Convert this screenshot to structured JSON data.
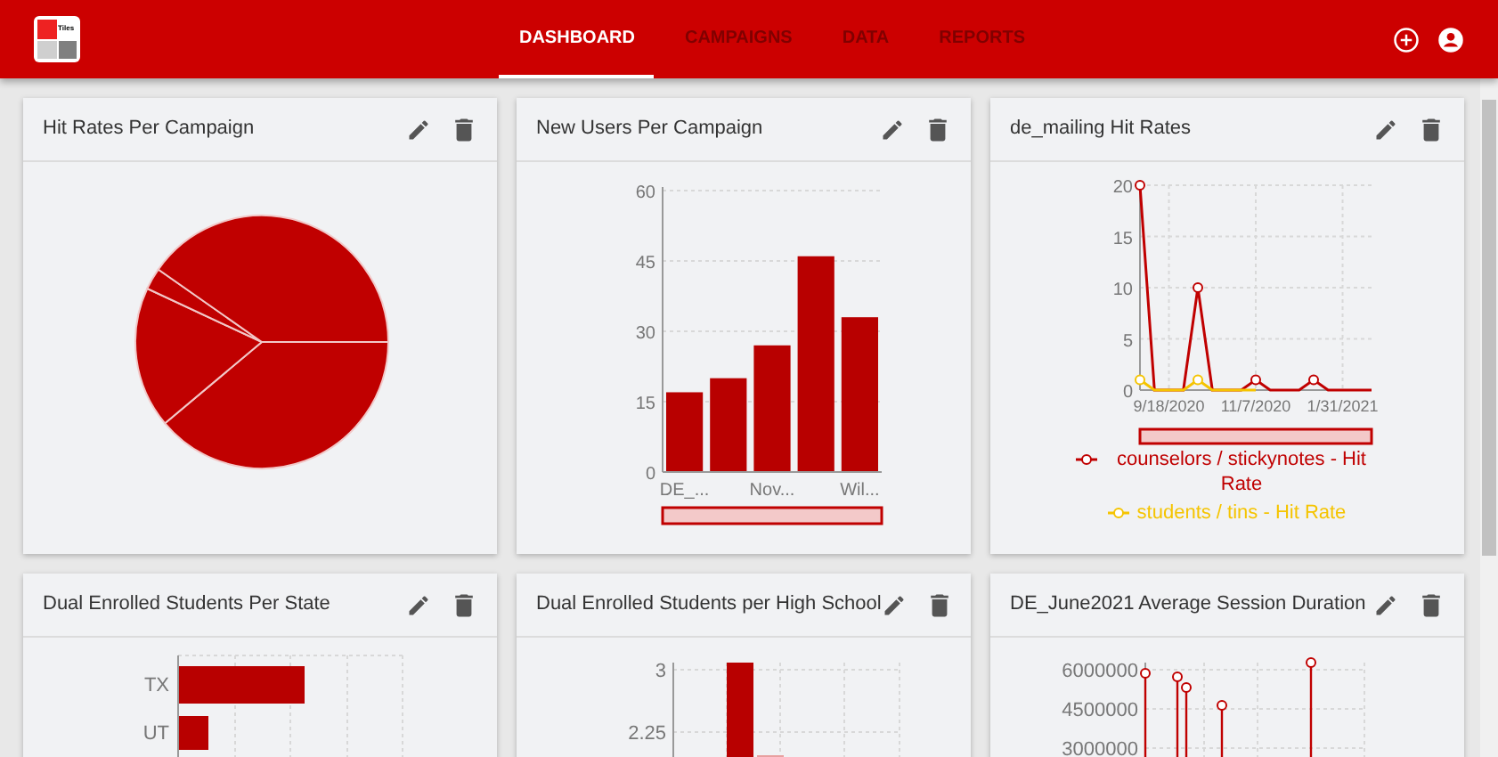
{
  "app": {
    "logo_text": "Tiles"
  },
  "nav": [
    {
      "label": "DASHBOARD",
      "selected": true
    },
    {
      "label": "CAMPAIGNS",
      "selected": false
    },
    {
      "label": "DATA",
      "selected": false
    },
    {
      "label": "REPORTS",
      "selected": false
    }
  ],
  "cards": [
    {
      "title": "Hit Rates Per Campaign",
      "kind": "pie"
    },
    {
      "title": "New Users Per Campaign",
      "kind": "bar",
      "chart_data": {
        "type": "bar",
        "categories": [
          "DE_...",
          null,
          "Nov...",
          null,
          "Wil..."
        ],
        "values": [
          17,
          20,
          27,
          46,
          33
        ],
        "grid": true,
        "ylim": [
          0,
          60
        ],
        "yticks": [
          0,
          15,
          30,
          45,
          60
        ]
      }
    },
    {
      "title": "de_mailing Hit Rates",
      "kind": "line",
      "chart_data": {
        "type": "line",
        "legend": "bottom",
        "categories": [
          null,
          null,
          "9/18/2020",
          null,
          null,
          null,
          null,
          null,
          "11/7/2020",
          null,
          null,
          null,
          null,
          null,
          "1/31/2021",
          null,
          null
        ],
        "grid": true,
        "ylim": [
          0,
          20
        ],
        "yticks": [
          0,
          5,
          10,
          15,
          20
        ],
        "series": [
          {
            "name": "counselors / stickynotes - Hit Rate",
            "color": "#c00000",
            "values": [
              20,
              0,
              0,
              0,
              10,
              0,
              0,
              0,
              1,
              0,
              0,
              0,
              1,
              0,
              0,
              0,
              0
            ]
          },
          {
            "name": "students / tins - Hit Rate",
            "color": "#f5c400",
            "values": [
              1,
              0,
              0,
              0,
              1,
              0,
              0,
              0,
              0,
              null,
              null,
              null,
              null,
              null,
              null,
              null,
              null
            ]
          }
        ]
      }
    },
    {
      "title": "Dual Enrolled Students Per State",
      "kind": "hbar",
      "tick_labels": [
        "TX",
        "UT"
      ]
    },
    {
      "title": "Dual Enrolled Students per High School",
      "kind": "vbar",
      "tick_labels": [
        "3",
        "2.25"
      ]
    },
    {
      "title": "DE_June2021 Average Session Duration",
      "kind": "lollipop",
      "tick_labels": [
        "6000000",
        "4500000",
        "3000000"
      ]
    }
  ]
}
